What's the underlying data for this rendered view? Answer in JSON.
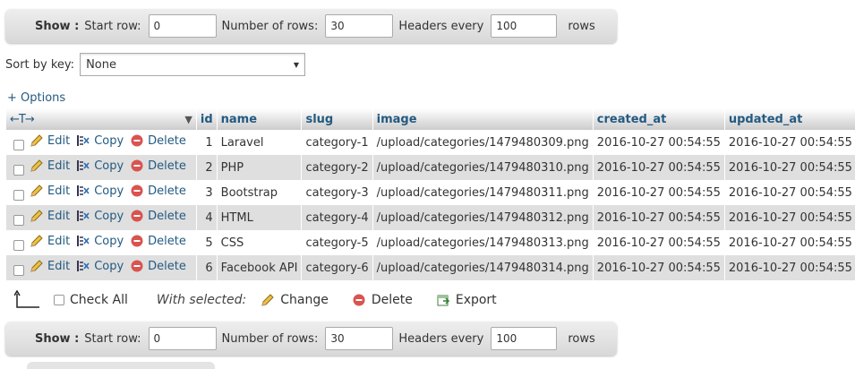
{
  "nav": {
    "show_label": "Show :",
    "start_row_label": "Start row:",
    "start_row_value": "0",
    "num_rows_label": "Number of rows:",
    "num_rows_value": "30",
    "headers_every_label": "Headers every",
    "headers_every_value": "100",
    "rows_label": "rows"
  },
  "sort": {
    "label": "Sort by key:",
    "selected": "None"
  },
  "options_link": "+ Options",
  "table": {
    "col_arrows": "←T→",
    "columns": [
      "id",
      "name",
      "slug",
      "image",
      "created_at",
      "updated_at"
    ],
    "action_labels": {
      "edit": "Edit",
      "copy": "Copy",
      "delete": "Delete"
    },
    "rows": [
      {
        "id": "1",
        "name": "Laravel",
        "slug": "category-1",
        "image": "/upload/categories/1479480309.png",
        "created_at": "2016-10-27 00:54:55",
        "updated_at": "2016-10-27 00:54:55"
      },
      {
        "id": "2",
        "name": "PHP",
        "slug": "category-2",
        "image": "/upload/categories/1479480310.png",
        "created_at": "2016-10-27 00:54:55",
        "updated_at": "2016-10-27 00:54:55"
      },
      {
        "id": "3",
        "name": "Bootstrap",
        "slug": "category-3",
        "image": "/upload/categories/1479480311.png",
        "created_at": "2016-10-27 00:54:55",
        "updated_at": "2016-10-27 00:54:55"
      },
      {
        "id": "4",
        "name": "HTML",
        "slug": "category-4",
        "image": "/upload/categories/1479480312.png",
        "created_at": "2016-10-27 00:54:55",
        "updated_at": "2016-10-27 00:54:55"
      },
      {
        "id": "5",
        "name": "CSS",
        "slug": "category-5",
        "image": "/upload/categories/1479480313.png",
        "created_at": "2016-10-27 00:54:55",
        "updated_at": "2016-10-27 00:54:55"
      },
      {
        "id": "6",
        "name": "Facebook API",
        "slug": "category-6",
        "image": "/upload/categories/1479480314.png",
        "created_at": "2016-10-27 00:54:55",
        "updated_at": "2016-10-27 00:54:55"
      }
    ]
  },
  "with_selected": {
    "check_all": "Check All",
    "label": "With selected:",
    "change": "Change",
    "delete": "Delete",
    "export": "Export"
  },
  "icons": {
    "edit": "pencil-icon",
    "copy": "copy-icon",
    "delete": "delete-icon",
    "export": "export-icon"
  },
  "colors": {
    "link": "#235a81",
    "delete_red": "#d9534f",
    "row_alt": "#dfdfdf"
  }
}
